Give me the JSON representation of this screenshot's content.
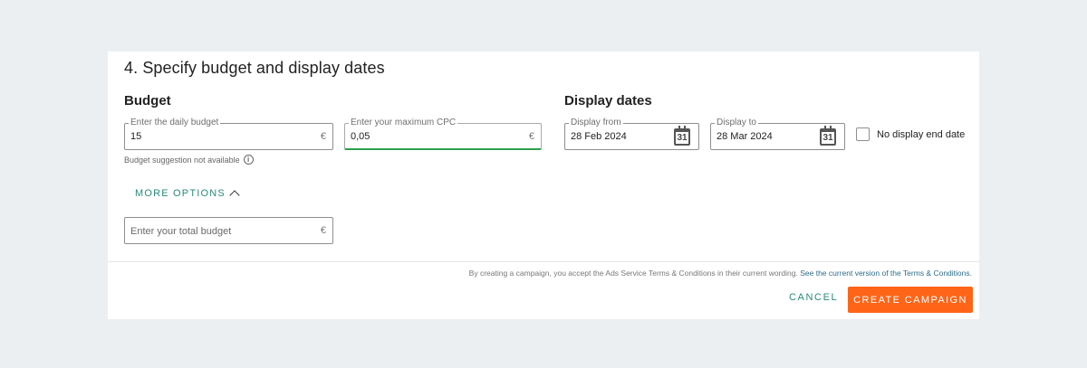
{
  "section": {
    "title": "4. Specify budget and display dates"
  },
  "budget": {
    "heading": "Budget",
    "daily": {
      "label": "Enter the daily budget",
      "value": "15",
      "currency": "€"
    },
    "cpc": {
      "label": "Enter your maximum CPC",
      "value": "0,05",
      "currency": "€"
    },
    "hint": "Budget suggestion not available",
    "more_options": "MORE OPTIONS",
    "total": {
      "placeholder": "Enter your total budget",
      "currency": "€"
    }
  },
  "dates": {
    "heading": "Display dates",
    "from": {
      "label": "Display from",
      "value": "28 Feb 2024",
      "cal_day": "31"
    },
    "to": {
      "label": "Display to",
      "value": "28 Mar 2024",
      "cal_day": "31"
    },
    "no_end_label": "No display end date"
  },
  "footer": {
    "terms_text": "By creating a campaign, you accept the Ads Service Terms & Conditions in their current wording.",
    "terms_link": "See the current version of the Terms & Conditions.",
    "cancel": "CANCEL",
    "create": "CREATE CAMPAIGN"
  },
  "colors": {
    "accent": "#2a8a7a",
    "primary_button": "#ff6417",
    "active_underline": "#2aa04a",
    "background": "#eceff2"
  },
  "icons": {
    "info": "info-icon",
    "calendar": "calendar-icon",
    "chevron": "chevron-up-icon"
  }
}
